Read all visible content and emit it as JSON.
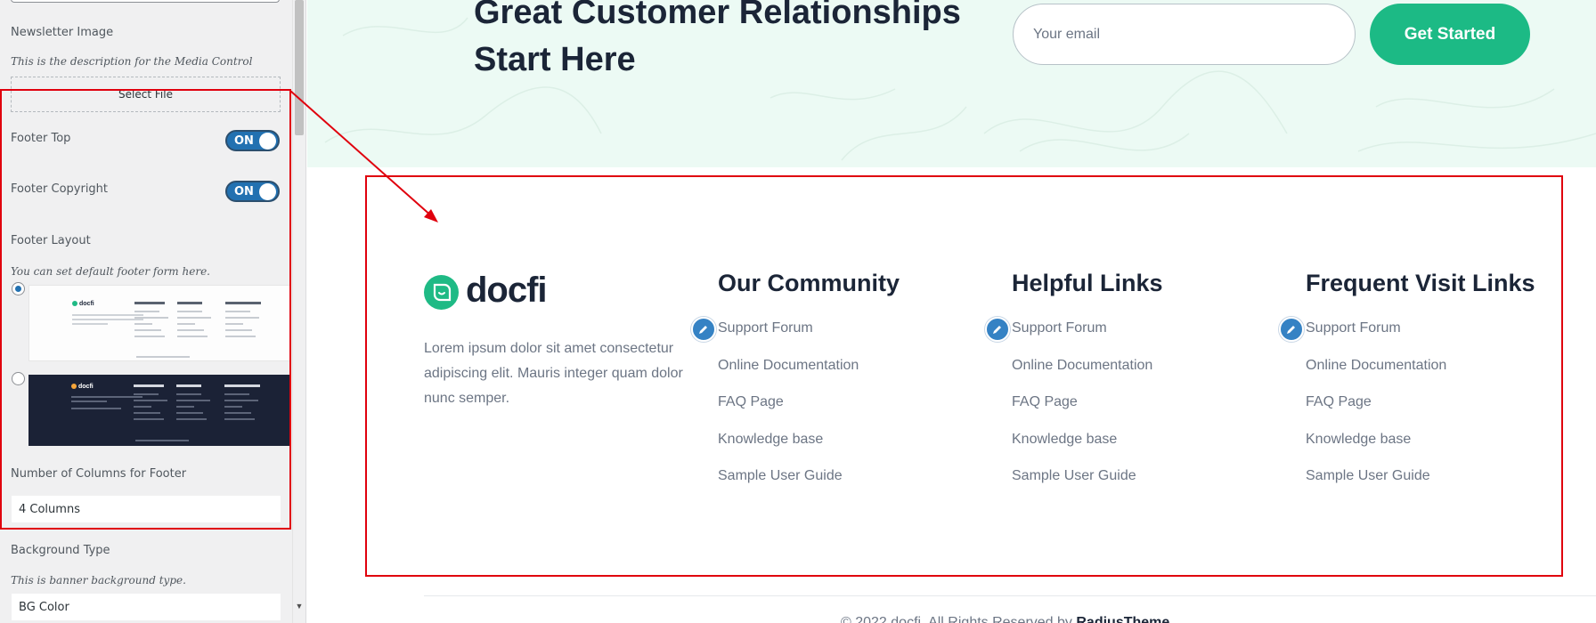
{
  "sidebar": {
    "newsletter_image_label": "Newsletter Image",
    "newsletter_image_desc": "This is the description for the Media Control",
    "select_file_label": "Select File",
    "footer_top_label": "Footer Top",
    "footer_top_state": "ON",
    "footer_copyright_label": "Footer Copyright",
    "footer_copyright_state": "ON",
    "footer_layout_label": "Footer Layout",
    "footer_layout_desc": "You can set default footer form here.",
    "columns_label": "Number of Columns for Footer",
    "columns_value": "4 Columns",
    "bg_type_label": "Background Type",
    "bg_type_desc": "This is banner background type.",
    "bg_type_value": "BG Color"
  },
  "hero": {
    "title": "Great Customer Relationships Start Here",
    "email_placeholder": "Your email",
    "cta_label": "Get Started"
  },
  "footer": {
    "logo_text": "docfi",
    "about": "Lorem ipsum dolor sit amet consectetur adipiscing elit. Mauris integer quam dolor nunc semper.",
    "columns": [
      {
        "title": "Our Community",
        "links": [
          "Support Forum",
          "Online Documentation",
          "FAQ Page",
          "Knowledge base",
          "Sample User Guide"
        ]
      },
      {
        "title": "Helpful Links",
        "links": [
          "Support Forum",
          "Online Documentation",
          "FAQ Page",
          "Knowledge base",
          "Sample User Guide"
        ]
      },
      {
        "title": "Frequent Visit Links",
        "links": [
          "Support Forum",
          "Online Documentation",
          "FAQ Page",
          "Knowledge base",
          "Sample User Guide"
        ]
      }
    ],
    "copyright_prefix": "© 2022 docfi. All Rights Reserved by",
    "copyright_brand": "RadiusTheme"
  },
  "colors": {
    "accent_green": "#1cba85",
    "wp_blue": "#2271b1",
    "annotation_red": "#e0000d",
    "heading_dark": "#1b2537"
  },
  "icons": {
    "edit": "pencil-icon",
    "logo": "docfi-logo-icon",
    "dropdown": "chevron-down-icon"
  }
}
